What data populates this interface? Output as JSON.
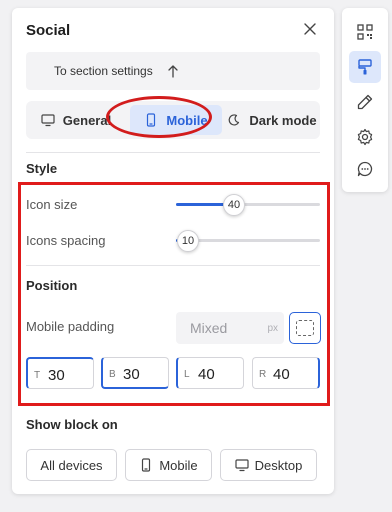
{
  "panel": {
    "title": "Social",
    "section_settings_label": "To section settings"
  },
  "tabs": [
    {
      "label": "General",
      "icon": "desktop-icon",
      "active": false
    },
    {
      "label": "Mobile",
      "icon": "mobile-icon",
      "active": true
    },
    {
      "label": "Dark mode",
      "icon": "moon-icon",
      "active": false
    }
  ],
  "style": {
    "title": "Style",
    "icon_size": {
      "label": "Icon size",
      "value": "40",
      "fraction": 0.4
    },
    "icons_spacing": {
      "label": "Icons spacing",
      "value": "10",
      "fraction": 0.05
    }
  },
  "position": {
    "title": "Position",
    "mobile_padding_label": "Mobile padding",
    "mobile_padding_value": "Mixed",
    "mobile_padding_unit": "px",
    "fields": [
      {
        "side": "T",
        "value": "30"
      },
      {
        "side": "B",
        "value": "30"
      },
      {
        "side": "L",
        "value": "40"
      },
      {
        "side": "R",
        "value": "40"
      }
    ]
  },
  "show_block_on": {
    "title": "Show block on",
    "options": [
      "All devices",
      "Mobile",
      "Desktop"
    ]
  },
  "toolbar": [
    "qr-code-icon",
    "brush-icon",
    "pencil-icon",
    "gear-icon",
    "chat-icon"
  ],
  "colors": {
    "accent": "#2b63d9",
    "active_tab_bg": "#dde7fb",
    "annotation_red": "#e01b1b"
  }
}
